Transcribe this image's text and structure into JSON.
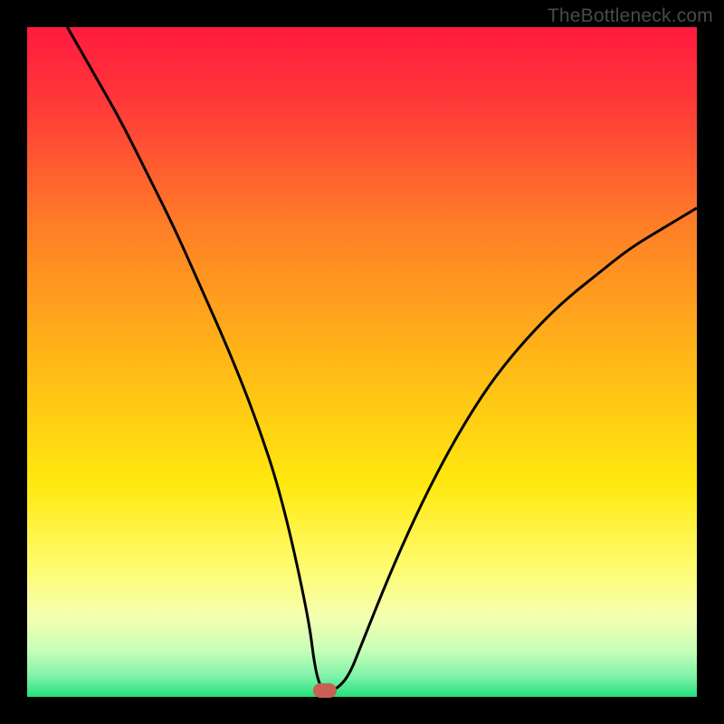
{
  "watermark": "TheBottleneck.com",
  "chart_data": {
    "type": "line",
    "title": "",
    "xlabel": "",
    "ylabel": "",
    "xlim": [
      0,
      100
    ],
    "ylim": [
      0,
      100
    ],
    "series": [
      {
        "name": "bottleneck-curve",
        "x": [
          6,
          10,
          14,
          18,
          22,
          26,
          30,
          34,
          38,
          42,
          43,
          44,
          45,
          46,
          48,
          50,
          54,
          58,
          62,
          66,
          70,
          75,
          80,
          85,
          90,
          95,
          100
        ],
        "values": [
          100,
          93,
          86,
          78,
          70,
          61,
          52,
          42,
          30,
          12,
          4,
          1,
          1,
          1,
          3,
          8,
          18,
          27,
          35,
          42,
          48,
          54,
          59,
          63,
          67,
          70,
          73
        ]
      }
    ],
    "marker": {
      "x": 44.5,
      "y": 1
    },
    "gradient_stops": [
      {
        "offset": 0.0,
        "color": "#ff1a3f"
      },
      {
        "offset": 0.12,
        "color": "#ff3b38"
      },
      {
        "offset": 0.3,
        "color": "#ff7f27"
      },
      {
        "offset": 0.5,
        "color": "#ffb817"
      },
      {
        "offset": 0.68,
        "color": "#ffe80e"
      },
      {
        "offset": 0.8,
        "color": "#fffb6a"
      },
      {
        "offset": 0.88,
        "color": "#f5ffb0"
      },
      {
        "offset": 0.93,
        "color": "#c8ffb8"
      },
      {
        "offset": 0.97,
        "color": "#7ef2a8"
      },
      {
        "offset": 1.0,
        "color": "#22e07a"
      }
    ],
    "marker_color": "#c96054",
    "curve_color": "#000000"
  }
}
